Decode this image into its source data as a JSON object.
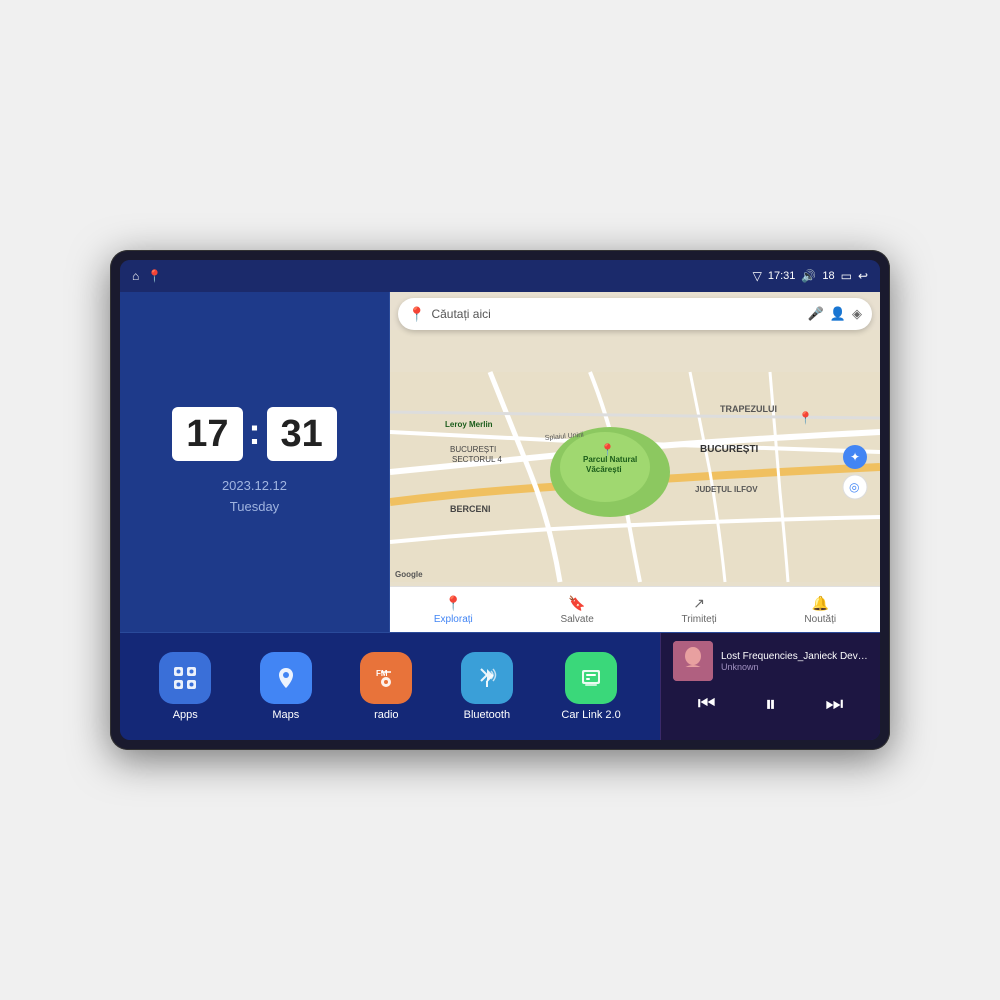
{
  "device": {
    "screen": {
      "status_bar": {
        "signal_icon": "▽",
        "time": "17:31",
        "volume_icon": "🔊",
        "battery_level": "18",
        "battery_icon": "▭",
        "back_icon": "↩"
      },
      "left_icons": [
        "⌂",
        "📍"
      ]
    },
    "clock_widget": {
      "hour": "17",
      "minute": "31",
      "date": "2023.12.12",
      "day": "Tuesday"
    },
    "map_widget": {
      "search_placeholder": "Căutați aici",
      "labels": [
        "TRAPEZULUI",
        "BUCUREȘTI",
        "JUDEȚUL ILFOV",
        "BERCENI",
        "Parcul Natural Văcărești",
        "Leroy Merlin"
      ],
      "bottom_items": [
        {
          "label": "Explorați",
          "active": true
        },
        {
          "label": "Salvate",
          "active": false
        },
        {
          "label": "Trimiteți",
          "active": false
        },
        {
          "label": "Noutăți",
          "active": false
        }
      ]
    },
    "apps": [
      {
        "id": "apps",
        "label": "Apps",
        "color": "icon-apps"
      },
      {
        "id": "maps",
        "label": "Maps",
        "color": "icon-maps"
      },
      {
        "id": "radio",
        "label": "radio",
        "color": "icon-radio"
      },
      {
        "id": "bluetooth",
        "label": "Bluetooth",
        "color": "icon-bluetooth"
      },
      {
        "id": "carlink",
        "label": "Car Link 2.0",
        "color": "icon-carlink"
      }
    ],
    "music": {
      "title": "Lost Frequencies_Janieck Devy-...",
      "artist": "Unknown",
      "prev_label": "⏮",
      "play_label": "⏸",
      "next_label": "⏭"
    }
  }
}
